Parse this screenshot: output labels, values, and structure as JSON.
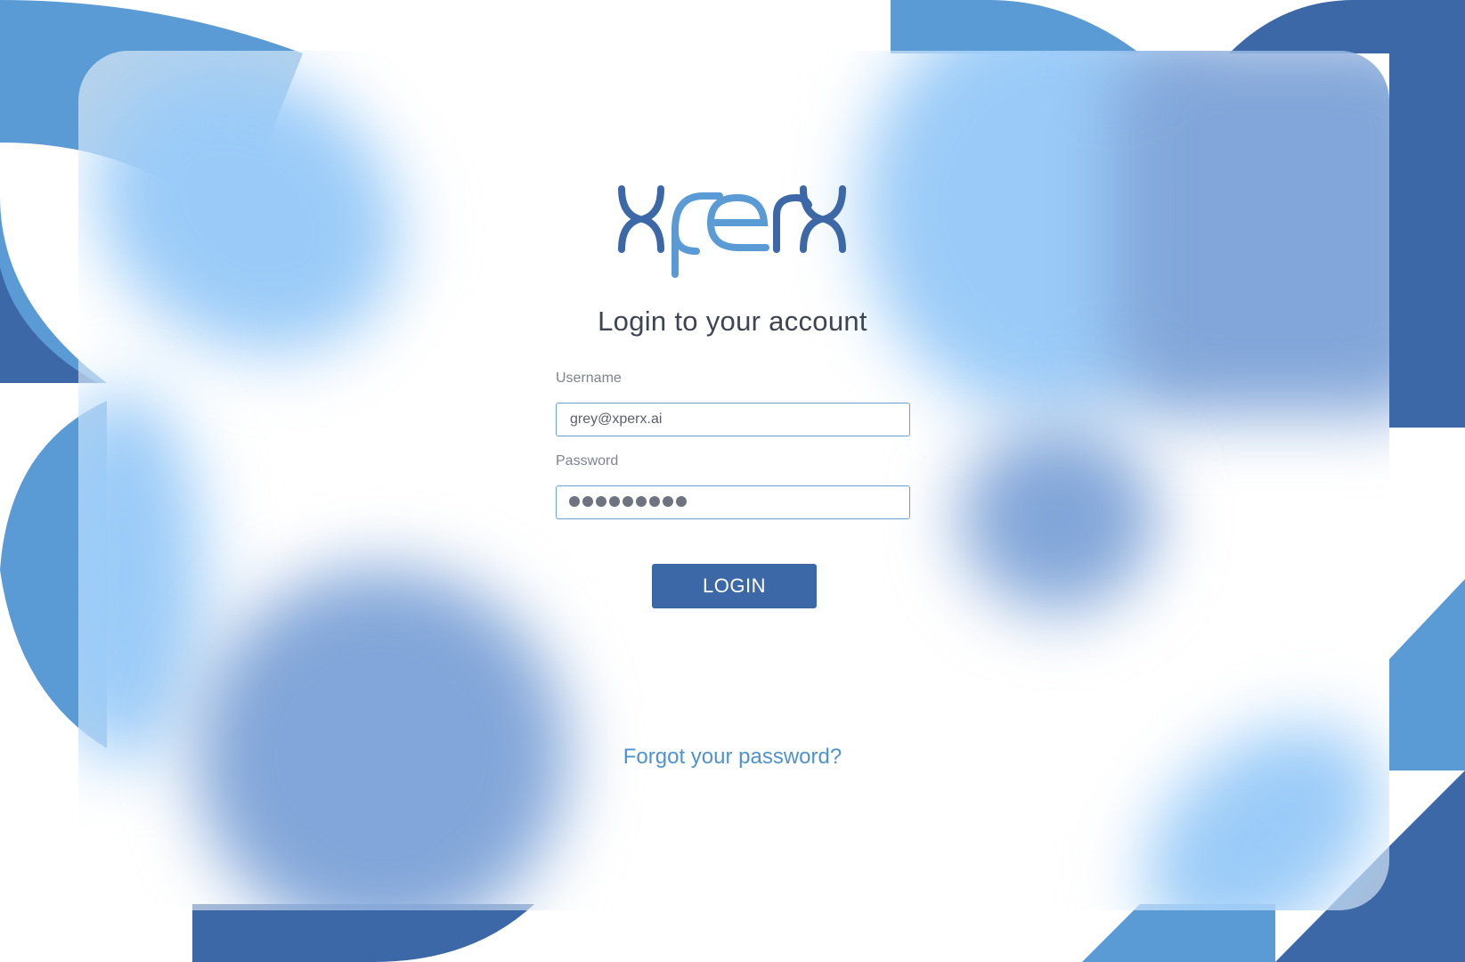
{
  "brand": {
    "logo_text": "xperx",
    "logo_color_dark": "#3d68a8",
    "logo_color_light": "#5b9bd5"
  },
  "login_form": {
    "title": "Login to your account",
    "username_label": "Username",
    "username_value": "grey@xperx.ai",
    "password_label": "Password",
    "password_length": 9,
    "submit_label": "LOGIN",
    "forgot_link": "Forgot your password?"
  },
  "colors": {
    "primary": "#3d68a8",
    "accent": "#5b9bd5",
    "light_blue": "#9acbf8",
    "medium_blue": "#82a6d9",
    "link": "#4e93cf"
  }
}
